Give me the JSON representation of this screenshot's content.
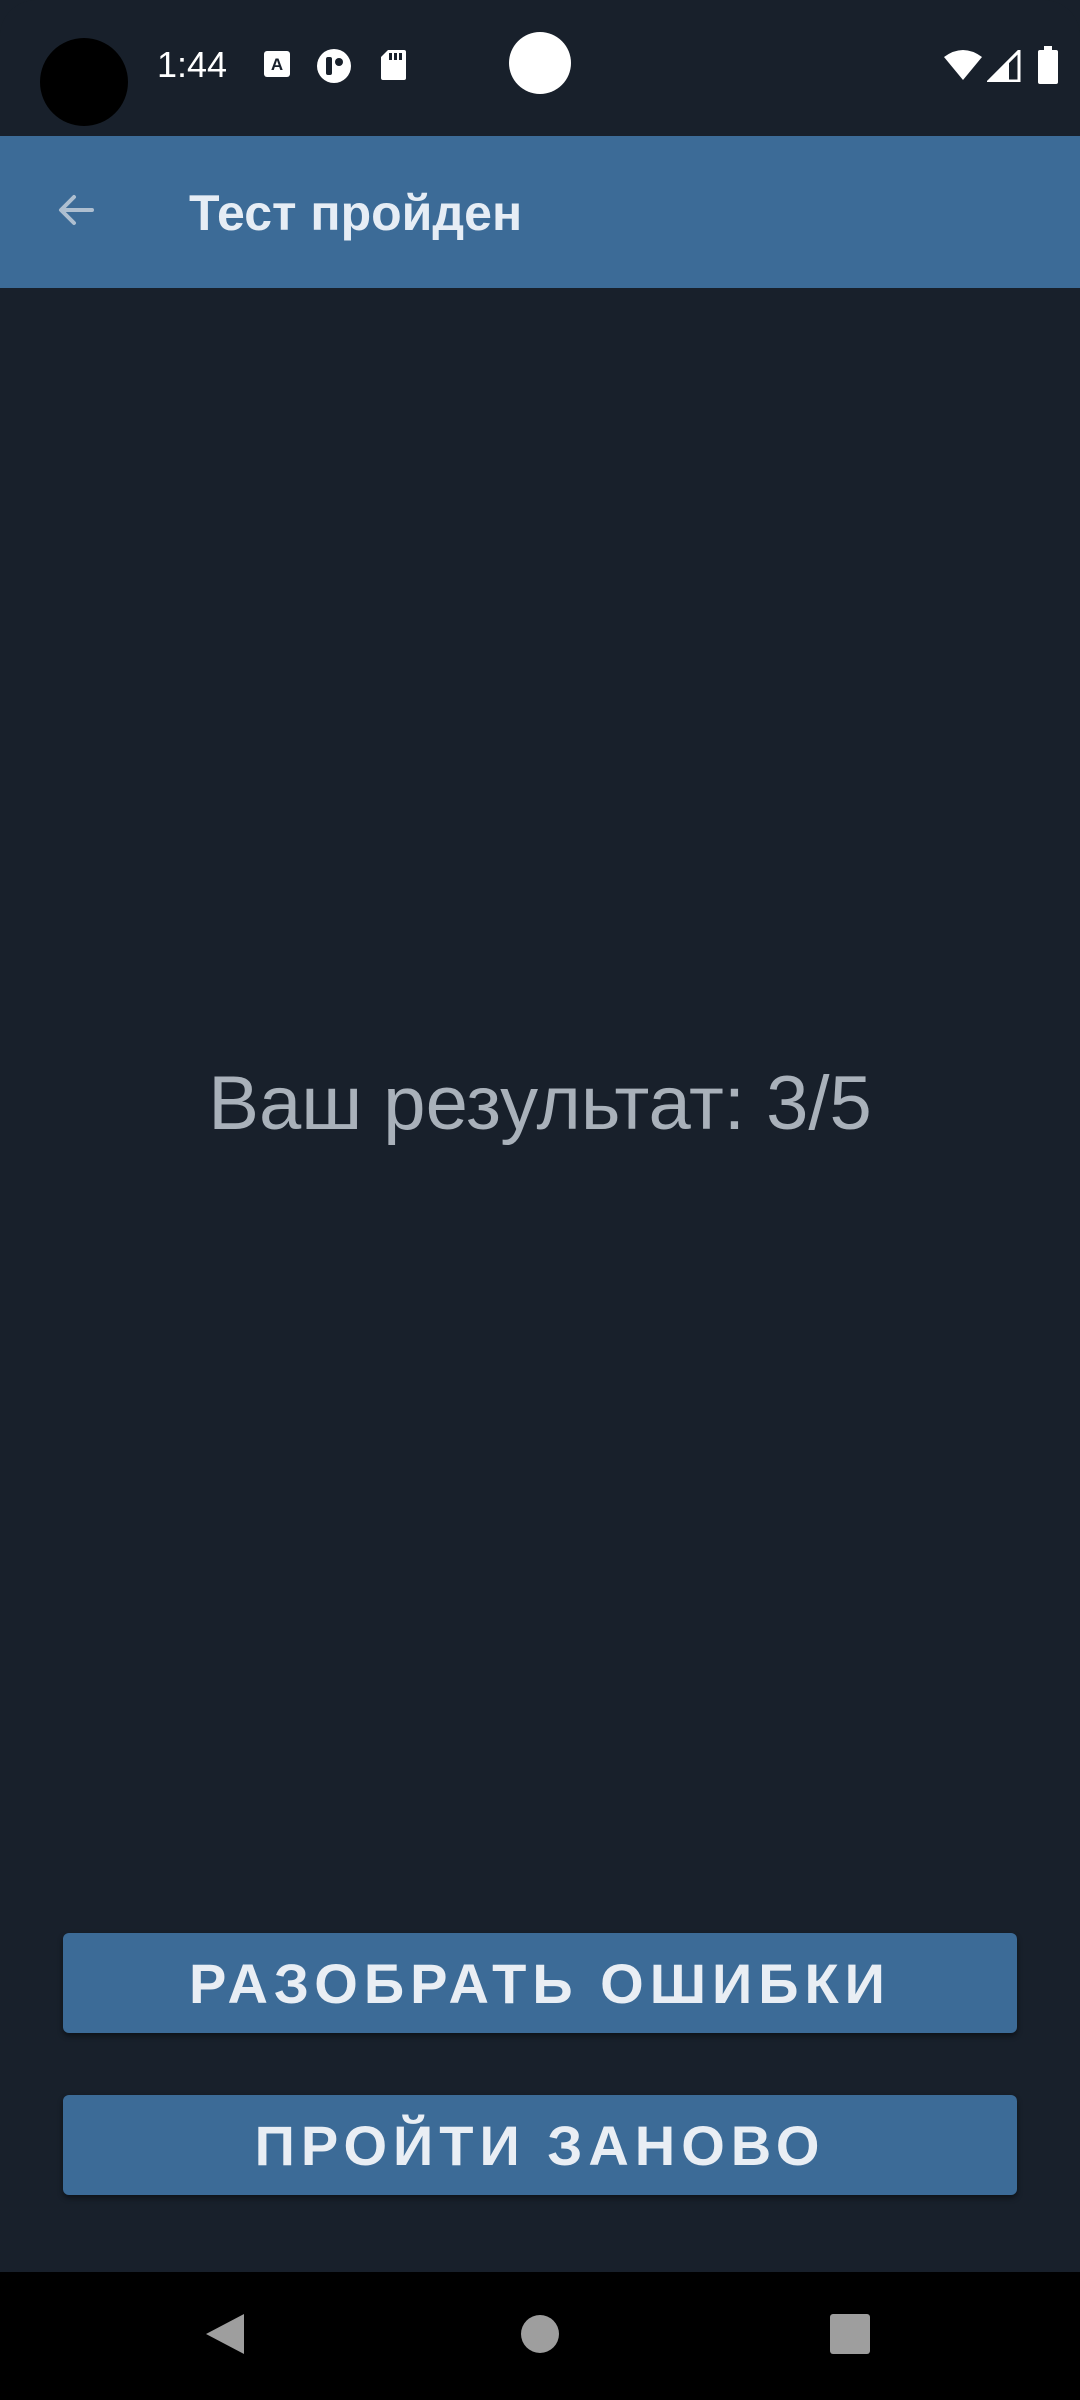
{
  "status_bar": {
    "time": "1:44",
    "icons": [
      "keyboard-a-icon",
      "game-controller-icon",
      "sd-card-icon",
      "wifi-icon",
      "cell-signal-icon",
      "battery-icon"
    ]
  },
  "app_bar": {
    "title": "Тест пройден",
    "back_icon": "arrow-back-icon"
  },
  "main": {
    "result": "Ваш результат: 3/5"
  },
  "buttons": {
    "review_label": "РАЗОБРАТЬ ОШИБКИ",
    "retry_label": "ПРОЙТИ ЗАНОВО"
  },
  "nav_bar": {
    "icons": [
      "nav-back-icon",
      "nav-home-icon",
      "nav-recents-icon"
    ]
  },
  "colors": {
    "background": "#18202b",
    "primary": "#3c6b97",
    "result_text": "#a9b1ba",
    "nav_background": "#000000"
  }
}
